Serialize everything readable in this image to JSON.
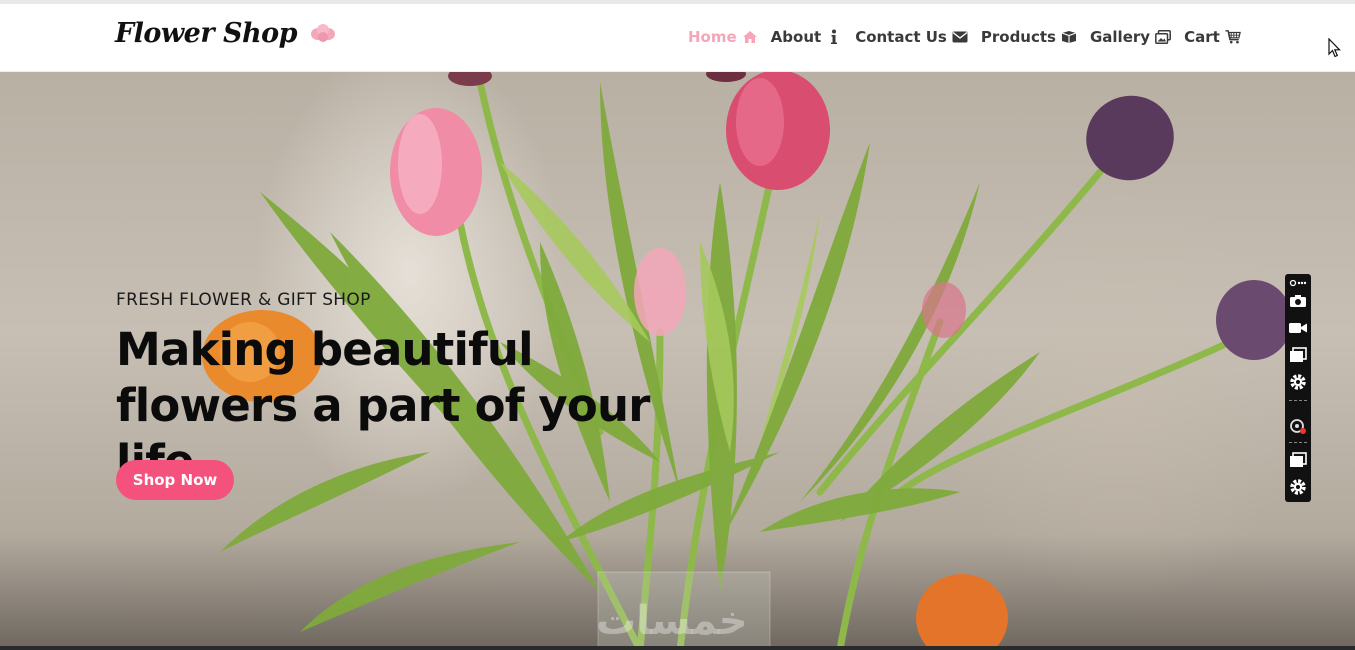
{
  "header": {
    "logo_text": "Flower Shop",
    "nav": [
      {
        "label": "Home",
        "icon": "home-icon",
        "active": true
      },
      {
        "label": "About",
        "icon": "info-icon",
        "active": false
      },
      {
        "label": "Contact Us",
        "icon": "envelope-icon",
        "active": false
      },
      {
        "label": "Products",
        "icon": "box-icon",
        "active": false
      },
      {
        "label": "Gallery",
        "icon": "images-icon",
        "active": false
      },
      {
        "label": "Cart",
        "icon": "cart-icon",
        "active": false
      }
    ]
  },
  "hero": {
    "eyebrow": "FRESH FLOWER & GIFT SHOP",
    "headline_line1": "Making beautiful",
    "headline_line2": "flowers a part of your life.",
    "cta_label": "Shop Now",
    "watermark": "خمسات"
  },
  "colors": {
    "accent": "#f4517d",
    "nav_active": "#f6a6b8",
    "nav_text": "#3a3a3a"
  },
  "toolbar": {
    "buttons": [
      "link-icon",
      "camera-icon",
      "video-icon",
      "window-icon",
      "gear-icon",
      "timer-icon",
      "window-icon",
      "gear-icon"
    ]
  }
}
